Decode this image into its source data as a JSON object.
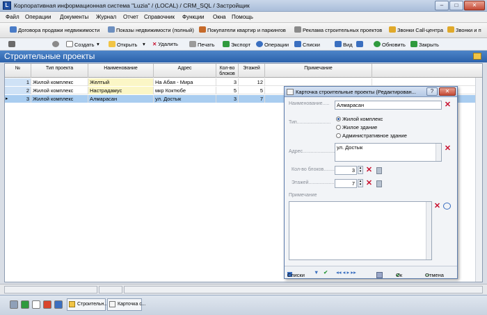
{
  "window": {
    "title": "Корпоративная информационная система \"Luzia\" / (LOCAL) / CRM_SQL / Застройщик",
    "app_icon": "L",
    "btn_min": "‒",
    "btn_max": "□",
    "btn_close": "✕"
  },
  "menu": [
    "Файл",
    "Операции",
    "Документы",
    "Журнал",
    "Отчет",
    "Справочник",
    "Функции",
    "Окна",
    "Помощь"
  ],
  "quickbar": [
    {
      "label": "Договора продажи недвижимости",
      "icon": "contract-icon",
      "color": "#4a7cc7"
    },
    {
      "label": "Показы недвижимости (полный)",
      "icon": "show-icon",
      "color": "#6d8fbf"
    },
    {
      "label": "Покупатели квартир и паркингов",
      "icon": "buyers-icon",
      "color": "#c66a2a"
    },
    {
      "label": "Реклама строительных проектов",
      "icon": "ad-icon",
      "color": "#8a8a8a"
    },
    {
      "label": "Звонки Call-центра",
      "icon": "calls-icon",
      "color": "#e0a92a"
    },
    {
      "label": "Звонки и п",
      "icon": "calls2-icon",
      "color": "#e0a92a"
    }
  ],
  "toolbar": [
    {
      "label": "",
      "icon": "back-icon",
      "color": "#6a6a6a"
    },
    {
      "label": "",
      "icon": "gear-icon",
      "color": "#8a8a8a"
    },
    {
      "label": "Создать",
      "icon": "new-doc-icon",
      "color": "#ffffff"
    },
    {
      "label": "▾",
      "icon": "",
      "color": ""
    },
    {
      "label": "Открыть",
      "icon": "open-folder-icon",
      "color": "#f1c445"
    },
    {
      "label": "▾",
      "icon": "",
      "color": ""
    },
    {
      "label": "Удалить",
      "icon": "delete-icon",
      "color": "#c8102e"
    },
    {
      "label": "Печать",
      "icon": "print-icon",
      "color": "#9a9a9a"
    },
    {
      "label": "Экспорт",
      "icon": "export-icon",
      "color": "#2f9a3e"
    },
    {
      "label": "Операции",
      "icon": "operations-icon",
      "color": "#3a6fc0"
    },
    {
      "label": "Списки",
      "icon": "lists-icon",
      "color": "#3a6fc0"
    },
    {
      "label": "Вид",
      "icon": "view-icon",
      "color": "#3a6fc0"
    },
    {
      "label": "",
      "icon": "filter-icon",
      "color": "#3a6fc0"
    },
    {
      "label": "Обновить",
      "icon": "refresh-icon",
      "color": "#2f9a3e"
    },
    {
      "label": "Закрыть",
      "icon": "close-arrow-icon",
      "color": "#2f9a3e"
    }
  ],
  "section": {
    "title": "Строительные проекты"
  },
  "grid": {
    "columns": [
      "№",
      "Тип проекта",
      "Наименование",
      "Адрес",
      "Кол-во\nблоков",
      "Этажей",
      "Примечание"
    ],
    "rows": [
      {
        "num": "1",
        "type": "Жилой комплекс",
        "name": "Желтый",
        "address": "На Абая - Мира",
        "blocks": "3",
        "floors": "12",
        "note": ""
      },
      {
        "num": "2",
        "type": "Жилой комплекс",
        "name": "Настрадамус",
        "address": "мкр Коктюбе",
        "blocks": "5",
        "floors": "5",
        "note": ""
      },
      {
        "num": "3",
        "type": "Жилой комплекс",
        "name": "Алмарасан",
        "address": "ул. Достык",
        "blocks": "3",
        "floors": "7",
        "note": ""
      }
    ],
    "current_marker": "▸"
  },
  "dialog": {
    "title": "Карточка строительные проекты (Редактирован...",
    "help": "?",
    "labels": {
      "name": "Наименование.....",
      "type": "Тип.........................",
      "address": "Адрес........................",
      "blocks": "Кол-во блоков........",
      "floors": "Этажей....................",
      "note": "Примечание"
    },
    "name_value": "Алмарасан",
    "type_options": [
      {
        "label": "Жилой комплекс",
        "selected": true
      },
      {
        "label": "Жилое здание",
        "selected": false
      },
      {
        "label": "Административное здание",
        "selected": false
      }
    ],
    "address_value": "ул. Достык",
    "blocks_value": "3",
    "floors_value": "7",
    "note_value": "",
    "footer": {
      "lists": "Списки",
      "ok": "Ок",
      "cancel": "Отмена",
      "nav": "◂◂ ◂ ▸ ▸▸"
    }
  },
  "taskbar": {
    "items": [
      "Строительн...",
      "Карточка с..."
    ]
  }
}
